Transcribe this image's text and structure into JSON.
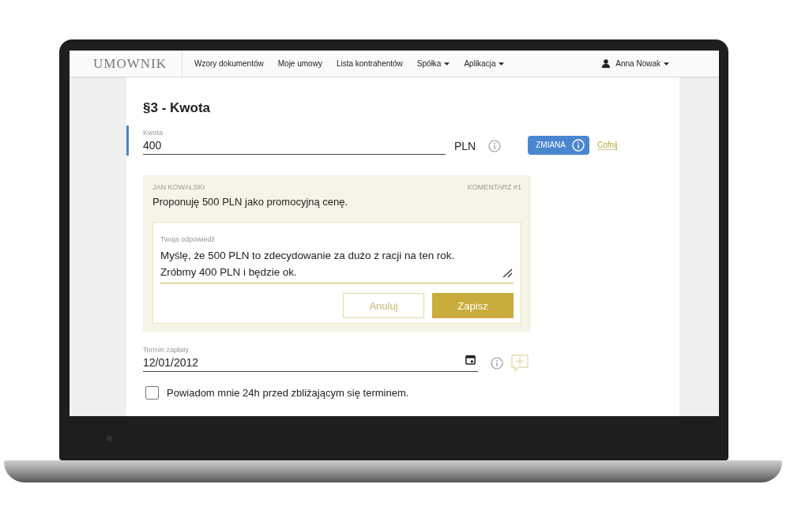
{
  "navbar": {
    "logo": "UMOWNIK",
    "items": [
      {
        "label": "Wzory dokumentów",
        "dropdown": false
      },
      {
        "label": "Moje umowy",
        "dropdown": false
      },
      {
        "label": "Lista kontrahentów",
        "dropdown": false
      },
      {
        "label": "Spółka",
        "dropdown": true
      },
      {
        "label": "Aplikacja",
        "dropdown": true
      }
    ],
    "user": {
      "name": "Anna Nowak",
      "dropdown": true
    }
  },
  "section": {
    "title": "§3 - Kwota",
    "amount": {
      "label": "Kwota",
      "value": "400",
      "unit": "PLN",
      "changed": true,
      "change_badge": "ZMIANA",
      "undo_link": "Cofnij"
    },
    "comment": {
      "author": "JAN KOWALSKI",
      "number": "KOMENTARZ #1",
      "text": "Proponuję 500 PLN jako promocyjną cenę.",
      "reply": {
        "label": "Twoja odpowiedź",
        "value": "Myślę, że 500 PLN to zdecydowanie za dużo z racji na ten rok. Zróbmy 400 PLN i będzie ok.",
        "buttons": [
          {
            "label": "Anuluj",
            "kind": "secondary"
          },
          {
            "label": "Zapisz",
            "kind": "primary"
          }
        ]
      }
    },
    "due_date": {
      "label": "Termin zapłaty",
      "value": "12/01/2012"
    },
    "reminder": {
      "label": "Powiadom mnie 24h przed zbliżającym się terminem.",
      "checked": false
    }
  }
}
